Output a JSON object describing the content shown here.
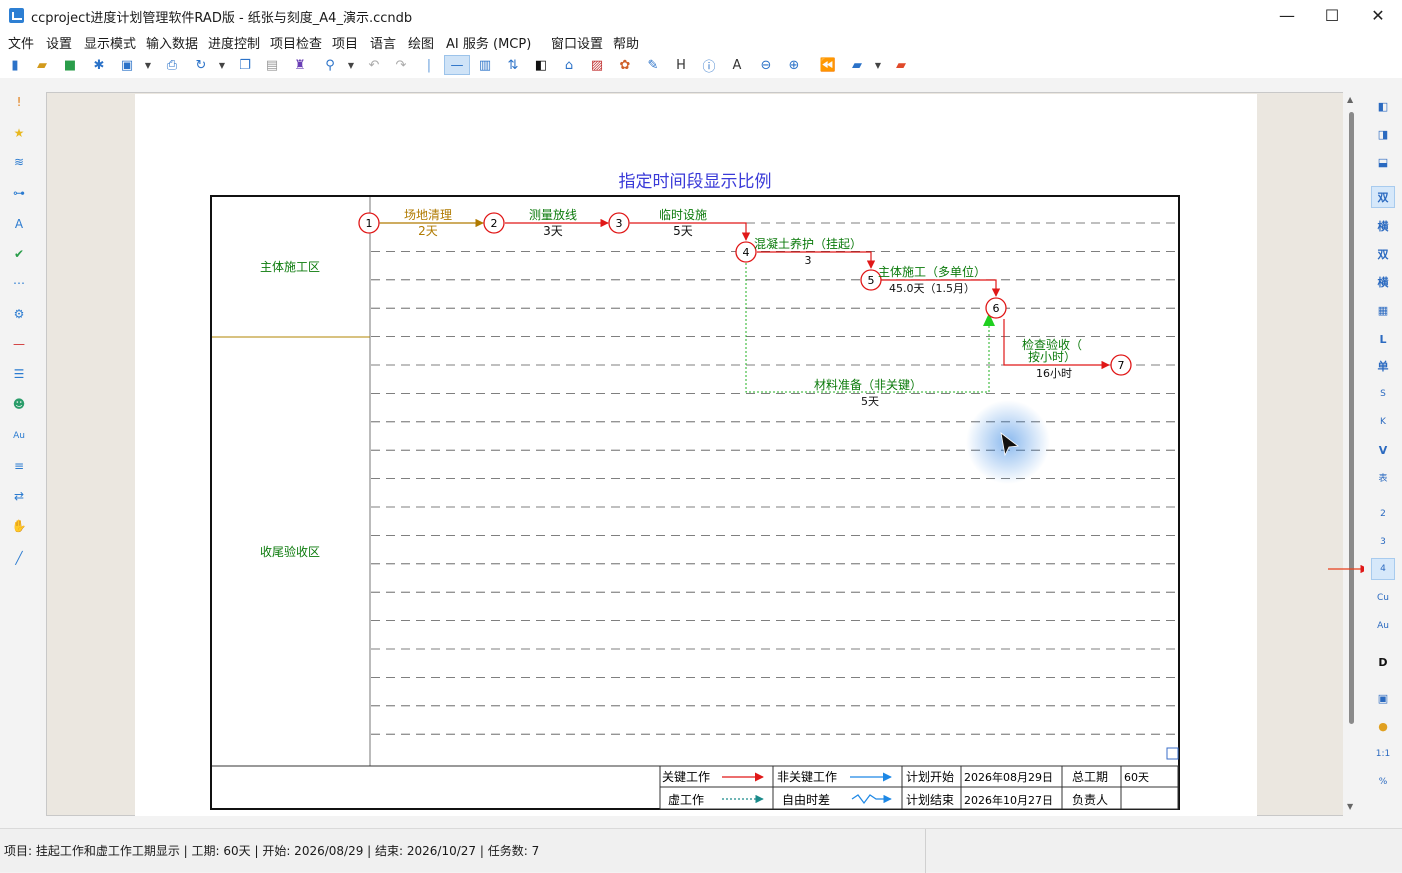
{
  "window": {
    "title": "ccproject进度计划管理软件RAD版 - 纸张与刻度_A4_演示.ccndb",
    "minimize": "—",
    "maximize": "☐",
    "close": "✕"
  },
  "menu": [
    "文件",
    "设置",
    "显示模式",
    "输入数据",
    "进度控制",
    "项目检查",
    "项目",
    "语言",
    "绘图",
    "AI 服务 (MCP)",
    "窗口设置",
    "帮助"
  ],
  "right_toolbar": {
    "double": "双",
    "horizontal": "横",
    "double_alt": "双",
    "horizontal_alt": "横",
    "l": "L",
    "single": "单",
    "s": "S",
    "k": "K",
    "v": "V",
    "table": "表",
    "two": "2",
    "three": "3",
    "four": "4",
    "cu": "Cu",
    "au": "Au",
    "d": "D",
    "ratio": "1:1",
    "percent": "%"
  },
  "diagram": {
    "title": "指定时间段显示比例",
    "zones": [
      "主体施工区",
      "收尾验收区"
    ],
    "nodes": [
      "1",
      "2",
      "3",
      "4",
      "5",
      "6",
      "7"
    ],
    "tasks": [
      {
        "name": "场地清理",
        "duration": "2天"
      },
      {
        "name": "测量放线",
        "duration": "3天"
      },
      {
        "name": "临时设施",
        "duration": "5天"
      },
      {
        "name": "混凝土养护（挂起）",
        "duration": "3"
      },
      {
        "name": "主体施工（多单位）",
        "duration": "45.0天（1.5月）"
      },
      {
        "name_line1": "检查验收（",
        "name_line2": "按小时）",
        "duration": "16小时"
      },
      {
        "name": "材料准备（非关键）",
        "duration": "5天"
      }
    ],
    "legend": {
      "critical": "关键工作",
      "noncritical": "非关键工作",
      "dummy": "虚工作",
      "free_float": "自由时差",
      "plan_start_label": "计划开始",
      "plan_start": "2026年08月29日",
      "plan_end_label": "计划结束",
      "plan_end": "2026年10月27日",
      "total_label": "总工期",
      "total": "60天",
      "owner_label": "负责人",
      "owner": ""
    }
  },
  "status": "项目: 挂起工作和虚工作工期显示 | 工期: 60天 | 开始: 2026/08/29 | 结束: 2026/10/27 | 任务数: 7",
  "colors": {
    "critical": "#e01818",
    "noncritical": "#1e88e5",
    "dummy": "#1a8a8a",
    "text_green": "#0b7a0b",
    "title_blue": "#3a3ad8"
  }
}
